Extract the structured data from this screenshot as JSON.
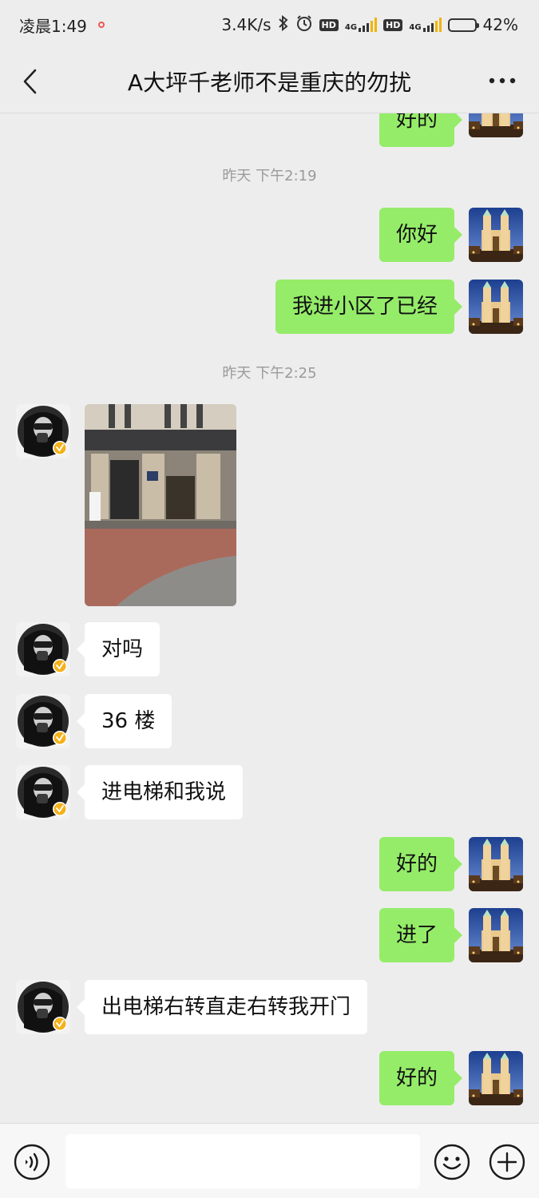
{
  "status_bar": {
    "time": "凌晨1:49",
    "speed": "3.4K/s",
    "network_1": "4G",
    "network_2": "4G",
    "hd": "HD",
    "battery": "42%",
    "battery_level": 0.42
  },
  "header": {
    "title": "A大坪千老师不是重庆的勿扰"
  },
  "chat": {
    "partial_top_message": "好的",
    "timestamps": [
      "昨天 下午2:19",
      "昨天 下午2:25"
    ],
    "messages": [
      {
        "side": "me",
        "text": "你好"
      },
      {
        "side": "me",
        "text": "我进小区了已经"
      },
      {
        "side": "them",
        "type": "image"
      },
      {
        "side": "them",
        "text": "对吗"
      },
      {
        "side": "them",
        "text": "36 楼"
      },
      {
        "side": "them",
        "text": "进电梯和我说"
      },
      {
        "side": "me",
        "text": "好的"
      },
      {
        "side": "me",
        "text": "进了"
      },
      {
        "side": "them",
        "text": "出电梯右转直走右转我开门"
      },
      {
        "side": "me",
        "text": "好的"
      }
    ]
  },
  "input_bar": {
    "placeholder": ""
  },
  "colors": {
    "background": "#ededed",
    "my_bubble": "#95ec69",
    "their_bubble": "#ffffff"
  },
  "icons": [
    "back-arrow-icon",
    "more-dots-icon",
    "voice-icon",
    "emoji-icon",
    "plus-icon",
    "verified-badge-icon"
  ]
}
